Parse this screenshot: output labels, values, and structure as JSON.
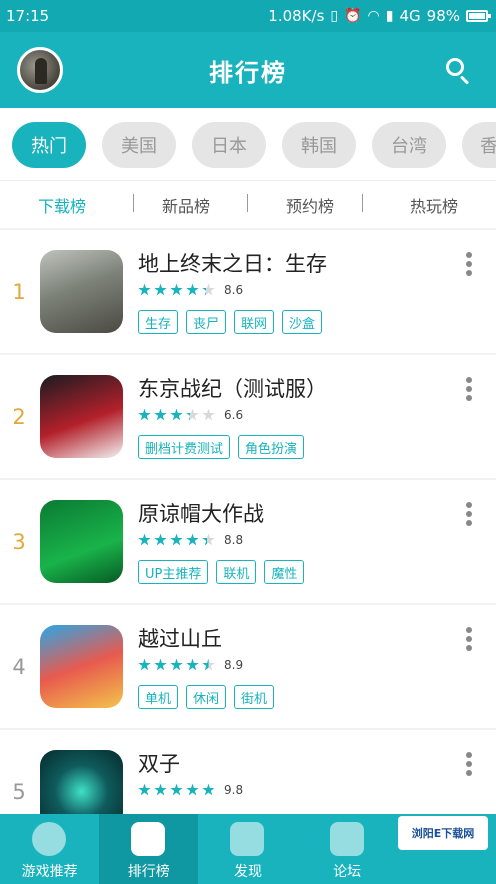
{
  "status_bar": {
    "time": "17:15",
    "speed": "1.08K/s",
    "network": "4G",
    "battery": "98%",
    "battery_level": 0.98
  },
  "header": {
    "title": "排行榜"
  },
  "regions": [
    "热门",
    "美国",
    "日本",
    "韩国",
    "台湾",
    "香"
  ],
  "rank_tabs": [
    "下载榜",
    "新品榜",
    "预约榜",
    "热玩榜"
  ],
  "games": [
    {
      "rank": "1",
      "name": "地上终末之日：生存",
      "rating": "8.6",
      "stars": 4.3,
      "tags": [
        "生存",
        "丧尸",
        "联网",
        "沙盒"
      ],
      "rank_color": "#e2a93a"
    },
    {
      "rank": "2",
      "name": "东京战纪（测试服）",
      "rating": "6.6",
      "stars": 3.3,
      "tags": [
        "删档计费测试",
        "角色扮演"
      ],
      "rank_color": "#e2a93a"
    },
    {
      "rank": "3",
      "name": "原谅帽大作战",
      "rating": "8.8",
      "stars": 4.4,
      "tags": [
        "UP主推荐",
        "联机",
        "魔性"
      ],
      "rank_color": "#e2a93a"
    },
    {
      "rank": "4",
      "name": "越过山丘",
      "rating": "8.9",
      "stars": 4.5,
      "tags": [
        "单机",
        "休闲",
        "街机"
      ],
      "rank_color": "#999999"
    },
    {
      "rank": "5",
      "name": "双子",
      "rating": "9.8",
      "stars": 4.9,
      "tags": [],
      "rank_color": "#999999"
    }
  ],
  "bottom_nav": [
    "游戏推荐",
    "排行榜",
    "发现",
    "论坛"
  ],
  "watermark": {
    "brand": "浏阳E下载网"
  },
  "colors": {
    "accent": "#18b3bd",
    "star_on": "#18b3bd",
    "star_off": "#d9d9d9"
  }
}
